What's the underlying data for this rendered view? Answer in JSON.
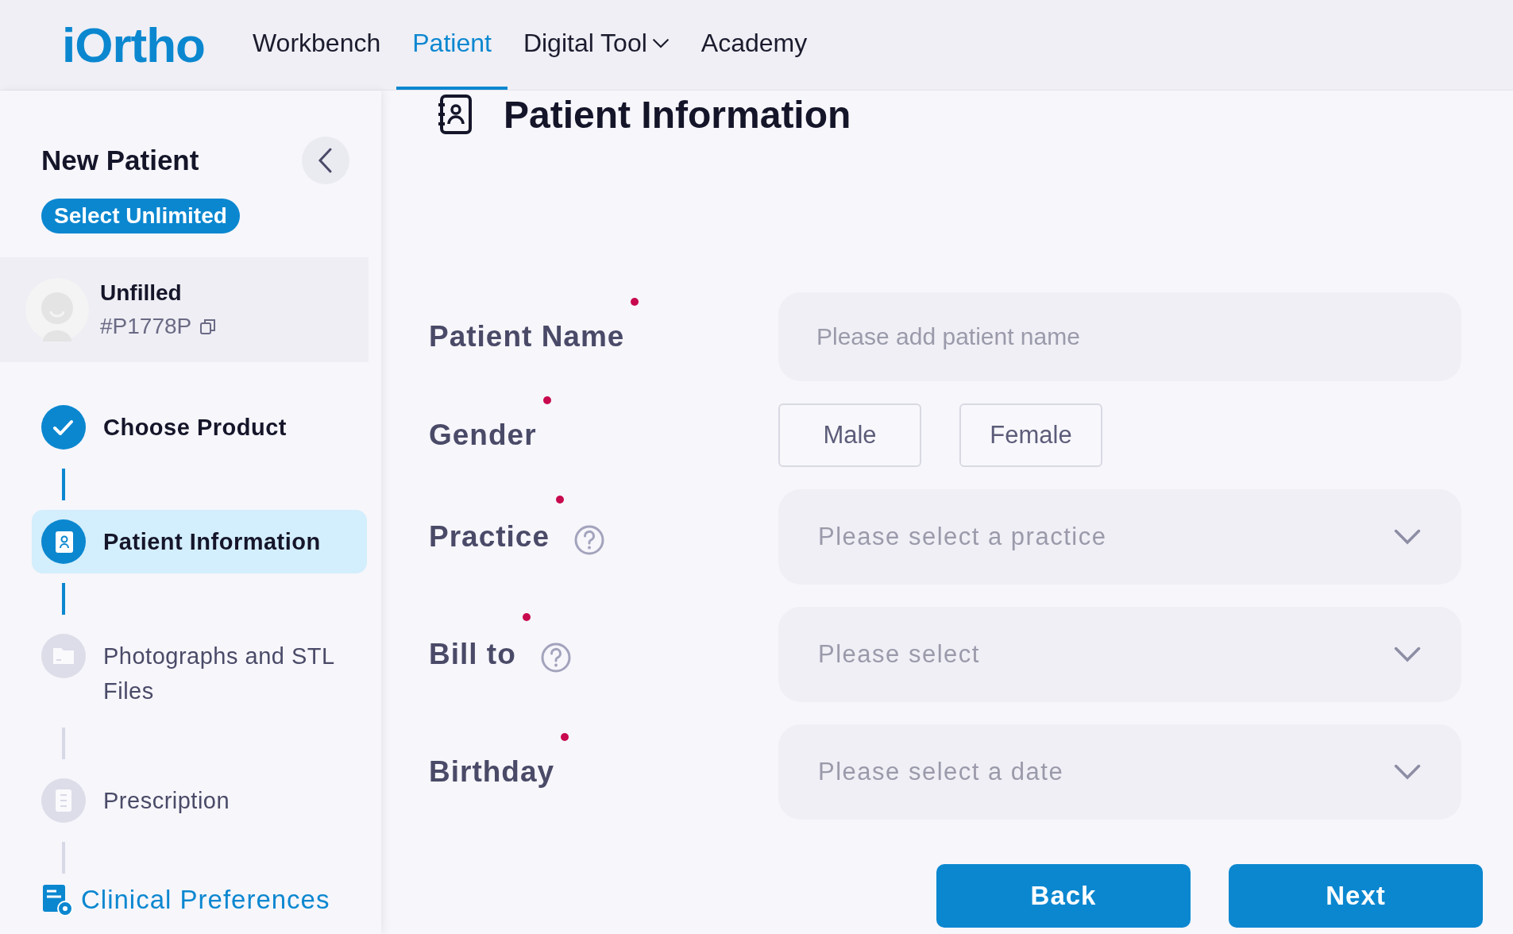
{
  "header": {
    "logo": "iOrtho",
    "nav": [
      {
        "label": "Workbench",
        "selected": false,
        "dropdown": false
      },
      {
        "label": "Patient",
        "selected": true,
        "dropdown": false
      },
      {
        "label": "Digital Tool",
        "selected": false,
        "dropdown": true
      },
      {
        "label": "Academy",
        "selected": false,
        "dropdown": false
      }
    ]
  },
  "sidebar": {
    "title": "New Patient",
    "badge": "Select Unlimited",
    "patient": {
      "name": "Unfilled",
      "id": "#P1778P"
    },
    "steps": [
      {
        "label": "Choose Product",
        "kind": "done"
      },
      {
        "label": "Patient Information",
        "kind": "current"
      },
      {
        "label": "Photographs and STL Files",
        "kind": "pending"
      },
      {
        "label": "Prescription",
        "kind": "pending"
      }
    ],
    "footer_link": "Clinical Preferences"
  },
  "main": {
    "title": "Patient Information",
    "fields": [
      {
        "label": "Patient Name",
        "required": true,
        "help": false,
        "kind": "text",
        "placeholder": "Please add patient name"
      },
      {
        "label": "Gender",
        "required": true,
        "help": false,
        "kind": "choice",
        "options": [
          {
            "label": "Male",
            "selected": false
          },
          {
            "label": "Female",
            "selected": false
          }
        ]
      },
      {
        "label": "Practice",
        "required": true,
        "help": true,
        "kind": "select",
        "placeholder": "Please select a practice"
      },
      {
        "label": "Bill to",
        "required": true,
        "help": true,
        "kind": "select",
        "placeholder": "Please select"
      },
      {
        "label": "Birthday",
        "required": true,
        "help": false,
        "kind": "select",
        "placeholder": "Please select a date"
      }
    ],
    "buttons": [
      "Back",
      "Next"
    ]
  }
}
